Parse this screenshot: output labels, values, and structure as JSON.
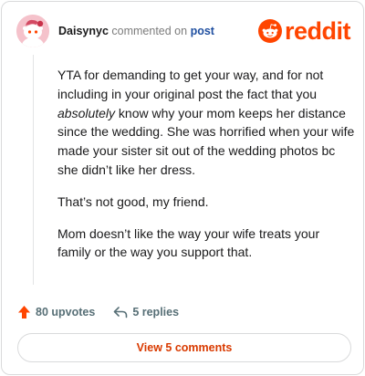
{
  "header": {
    "username": "Daisynyc",
    "action_text": "commented on",
    "target_text": "post",
    "brand_word": "reddit",
    "brand_color": "#ff4500",
    "avatar_icon": "snoo-avatar-icon"
  },
  "comment": {
    "p1_before": "YTA for demanding to get your way, and for not including in your original post the fact that you ",
    "p1_emphasis": "absolutely",
    "p1_after": " know why your mom keeps her distance since the wedding. She was horrified when your wife made your sister sit out of the wedding photos bc she didn’t like her dress.",
    "p2": "That’s not good, my friend.",
    "p3": "Mom doesn’t like the way your wife treats your family or the way you support that."
  },
  "actions": {
    "upvotes_label": "80 upvotes",
    "upvote_icon": "upvote-arrow-icon",
    "replies_label": "5 replies",
    "reply_icon": "reply-icon",
    "upvote_color": "#ff4500"
  },
  "footer": {
    "view_comments_label": "View 5 comments",
    "accent_color": "#d93a00"
  }
}
